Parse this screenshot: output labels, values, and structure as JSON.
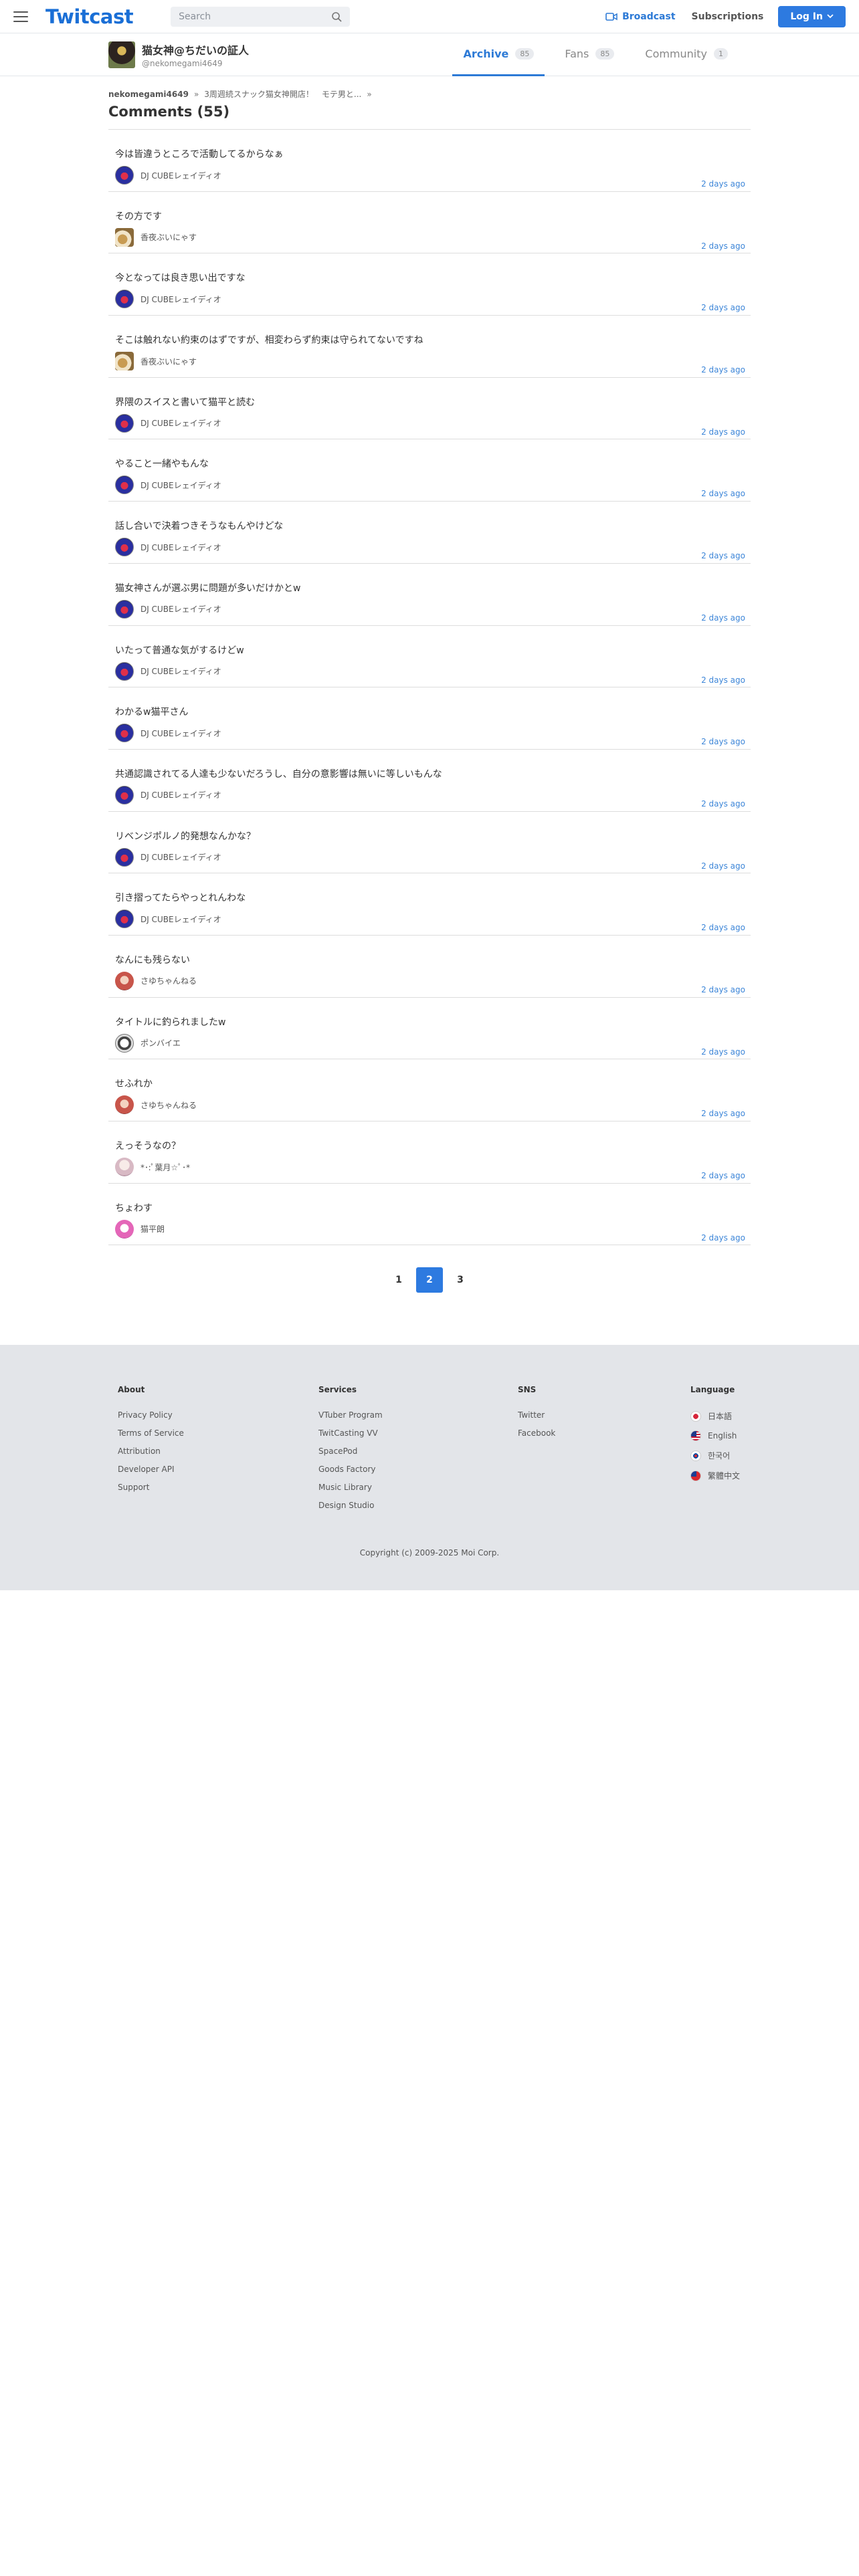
{
  "header": {
    "logo": "Twitcast",
    "search_placeholder": "Search",
    "broadcast": "Broadcast",
    "subscriptions": "Subscriptions",
    "login": "Log In"
  },
  "user": {
    "name": "猫女神@ちだいの証人",
    "id": "@nekomegami4649"
  },
  "tabs": [
    {
      "label": "Archive",
      "count": "85"
    },
    {
      "label": "Fans",
      "count": "85"
    },
    {
      "label": "Community",
      "count": "1"
    }
  ],
  "breadcrumb": [
    "nekomegami4649",
    "3周週続スナック猫女神開店！　モテ男と..."
  ],
  "title": "Comments (55)",
  "comments": [
    {
      "text": "今は皆違うところで活動してるからなぁ",
      "user": "DJ CUBEレェイディオ",
      "time": "2 days ago"
    },
    {
      "text": "その方です",
      "user": "香夜ぶいにゃす",
      "time": "2 days ago"
    },
    {
      "text": "今となっては良き思い出ですな",
      "user": "DJ CUBEレェイディオ",
      "time": "2 days ago"
    },
    {
      "text": "そこは触れない約束のはずですが、相変わらず約束は守られてないですね",
      "user": "香夜ぶいにゃす",
      "time": "2 days ago"
    },
    {
      "text": "界隈のスイスと書いて猫平と読む",
      "user": "DJ CUBEレェイディオ",
      "time": "2 days ago"
    },
    {
      "text": "やること一緒やもんな",
      "user": "DJ CUBEレェイディオ",
      "time": "2 days ago"
    },
    {
      "text": "話し合いで決着つきそうなもんやけどな",
      "user": "DJ CUBEレェイディオ",
      "time": "2 days ago"
    },
    {
      "text": "猫女神さんが選ぶ男に問題が多いだけかとw",
      "user": "DJ CUBEレェイディオ",
      "time": "2 days ago"
    },
    {
      "text": "いたって普通な気がするけどw",
      "user": "DJ CUBEレェイディオ",
      "time": "2 days ago"
    },
    {
      "text": "わかるw猫平さん",
      "user": "DJ CUBEレェイディオ",
      "time": "2 days ago"
    },
    {
      "text": "共通認識されてる人達も少ないだろうし、自分の意影響は無いに等しいもんな",
      "user": "DJ CUBEレェイディオ",
      "time": "2 days ago"
    },
    {
      "text": "リベンジポルノ的発想なんかな？",
      "user": "DJ CUBEレェイディオ",
      "time": "2 days ago"
    },
    {
      "text": "引き摺ってたらやっとれんわな",
      "user": "DJ CUBEレェイディオ",
      "time": "2 days ago"
    },
    {
      "text": "なんにも残らない",
      "user": "さゆちゃんねる",
      "time": "2 days ago"
    },
    {
      "text": "タイトルに釣られましたw",
      "user": "ポンバイエ",
      "time": "2 days ago"
    },
    {
      "text": "せふれか",
      "user": "さゆちゃんねる",
      "time": "2 days ago"
    },
    {
      "text": "えっそうなの？",
      "user": "*･:ﾟ葉月☆ﾟ･*",
      "time": "2 days ago"
    },
    {
      "text": "ちょわす",
      "user": "猫平朗",
      "time": "2 days ago"
    }
  ],
  "pagination": [
    "1",
    "2",
    "3"
  ],
  "footer": {
    "about_title": "About",
    "about": [
      "Privacy Policy",
      "Terms of Service",
      "Attribution",
      "Developer API",
      "Support"
    ],
    "services_title": "Services",
    "services": [
      "VTuber Program",
      "TwitCasting VV",
      "SpacePod",
      "Goods Factory",
      "Music Library",
      "Design Studio"
    ],
    "sns_title": "SNS",
    "sns": [
      "Twitter",
      "Facebook"
    ],
    "language_title": "Language",
    "languages": [
      "日本語",
      "English",
      "한국어",
      "繁體中文"
    ],
    "copyright": "Copyright (c) 2009-2025 Moi Corp."
  }
}
